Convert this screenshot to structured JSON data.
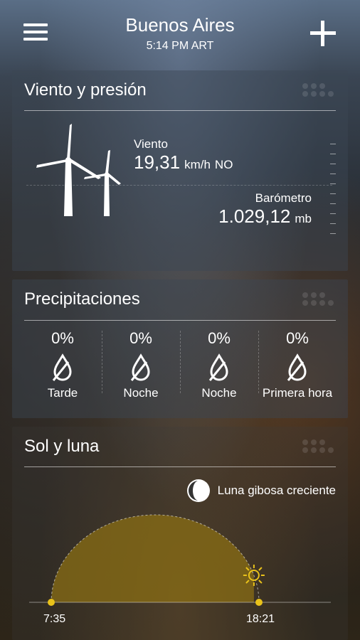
{
  "header": {
    "city": "Buenos Aires",
    "time": "5:14 PM ART"
  },
  "wind_pressure": {
    "title": "Viento y presión",
    "wind_label": "Viento",
    "wind_speed": "19,31",
    "wind_unit": "km/h",
    "wind_direction": "NO",
    "barometer_label": "Barómetro",
    "barometer_value": "1.029,12",
    "barometer_unit": "mb"
  },
  "precipitation": {
    "title": "Precipitaciones",
    "periods": [
      {
        "percent": "0%",
        "label": "Tarde"
      },
      {
        "percent": "0%",
        "label": "Noche"
      },
      {
        "percent": "0%",
        "label": "Noche"
      },
      {
        "percent": "0%",
        "label": "Primera hora"
      }
    ]
  },
  "sun_moon": {
    "title": "Sol y luna",
    "moon_phase": "Luna gibosa creciente",
    "sunrise": "7:35",
    "sunset": "18:21",
    "day_progress": 0.9
  },
  "colors": {
    "sun_accent": "#e9c21a",
    "daylight_fill": "#8a6d14"
  }
}
